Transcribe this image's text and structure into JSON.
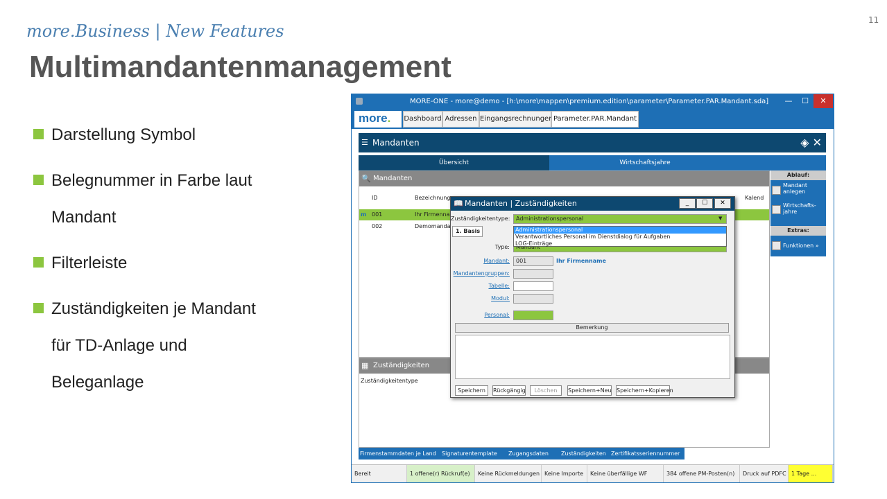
{
  "slide": {
    "subtitle": "more.Business | New Features",
    "title": "Multimandantenmanagement",
    "page_number": "11",
    "bullets": [
      "Darstellung Symbol",
      "Belegnummer in Farbe laut\nMandant",
      "Filterleiste",
      "Zuständigkeiten je Mandant\nfür TD-Anlage und\nBeleganlage"
    ]
  },
  "app": {
    "window_title": "MORE-ONE - more@demo - [h:\\more\\mappen\\premium.edition\\parameter\\Parameter.PAR.Mandant.sda]",
    "logo": "more",
    "logo_dot": ".",
    "tabs": [
      "Dashboard",
      "Adressen",
      "Eingangsrechnungen",
      "Parameter.PAR.Mandant"
    ],
    "header_title": "Mandanten",
    "subtabs": [
      "Übersicht",
      "Wirtschaftsjahre"
    ],
    "grid_title": "Mandanten",
    "grid_columns": [
      "ID",
      "Bezeichnung",
      "Kalend"
    ],
    "grid_rows": [
      {
        "id": "001",
        "name": "Ihr Firmenna"
      },
      {
        "id": "002",
        "name": "Demomandar"
      }
    ],
    "side_panel": {
      "ablauf_header": "Ablauf:",
      "item1": "Mandant\nanlegen",
      "item2": "Wirtschafts-\njahre",
      "extras_header": "Extras:",
      "item3": "Funktionen »"
    },
    "lower_title": "Zuständigkeiten",
    "lower_column": "Zuständigkeitentype",
    "bottom_tabs": [
      "Firmenstammdaten je Land",
      "Signaturentemplate",
      "Zugangsdaten",
      "Zuständigkeiten",
      "Zertifikatsseriennummer"
    ],
    "status": [
      "Bereit",
      "1 offene(r) Rückruf(e)",
      "Keine Rückmeldungen",
      "Keine Importe",
      "Keine überfällige WF",
      "384 offene PM-Posten(n)",
      "Druck auf PDFC",
      "1 Tage ..."
    ],
    "dialog": {
      "title": "Mandanten | Zuständigkeiten",
      "type_label": "Zuständigkeitentype:",
      "type_value": "Administrationspersonal",
      "dropdown_options": [
        "Administrationspersonal",
        "Verantwortliches Personal im Dienstdialog für Aufgaben",
        "LOG-Einträge"
      ],
      "tab_basis": "1. Basis",
      "field_type_label": "Type:",
      "field_type_value": "Mandant",
      "mandant_label": "Mandant:",
      "mandant_value": "001",
      "mandant_name": "Ihr Firmenname",
      "mandantengruppen_label": "Mandantengruppen:",
      "tabelle_label": "Tabelle:",
      "modul_label": "Modul:",
      "personal_label": "Personal:",
      "bemerkung": "Bemerkung",
      "buttons": [
        "Speichern",
        "Rückgängig",
        "Löschen",
        "Speichern+Neu",
        "Speichern+Kopieren"
      ]
    }
  },
  "colors": {
    "accent_green": "#8cc63f",
    "app_blue": "#1e6fb5",
    "dark_blue": "#0d4870"
  }
}
